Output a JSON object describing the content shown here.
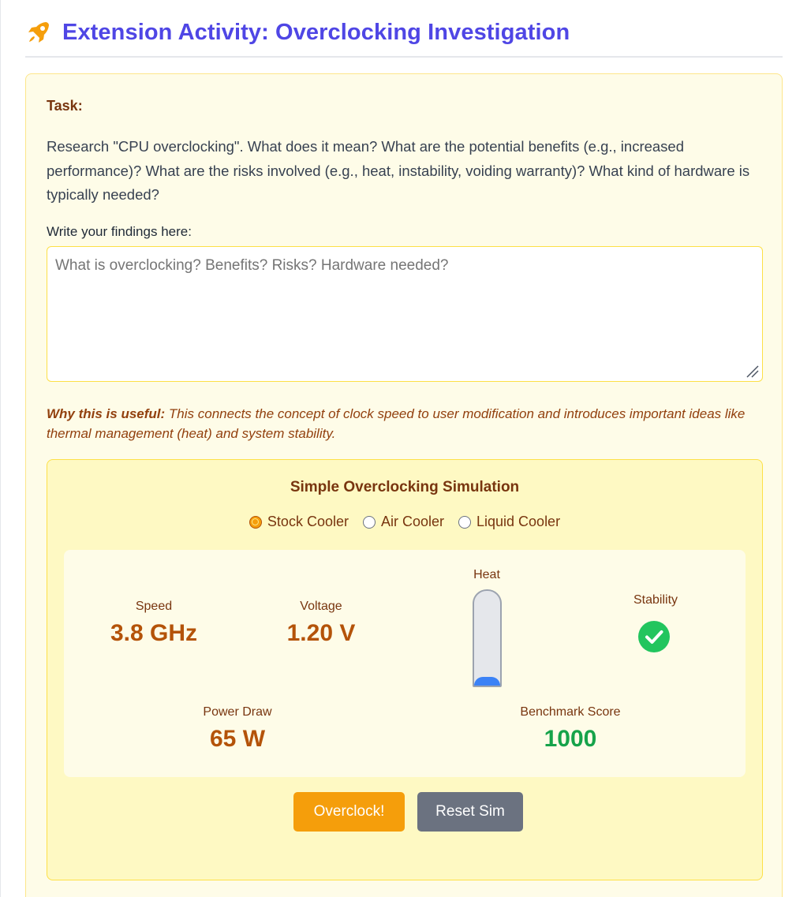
{
  "header": {
    "icon": "rocket-icon",
    "title": "Extension Activity: Overclocking Investigation"
  },
  "task": {
    "label": "Task:",
    "text": "Research \"CPU overclocking\". What does it mean? What are the potential benefits (e.g., increased performance)? What are the risks involved (e.g., heat, instability, voiding warranty)? What kind of hardware is typically needed?",
    "findings_label": "Write your findings here:",
    "findings_value": "",
    "findings_placeholder": "What is overclocking? Benefits? Risks? Hardware needed?",
    "why_prefix": "Why this is useful:",
    "why_text": "This connects the concept of clock speed to user modification and introduces important ideas like thermal management (heat) and system stability."
  },
  "simulation": {
    "title": "Simple Overclocking Simulation",
    "coolers": [
      {
        "label": "Stock Cooler",
        "checked": true
      },
      {
        "label": "Air Cooler",
        "checked": false
      },
      {
        "label": "Liquid Cooler",
        "checked": false
      }
    ],
    "speed": {
      "label": "Speed",
      "value": "3.8 GHz"
    },
    "voltage": {
      "label": "Voltage",
      "value": "1.20 V"
    },
    "heat": {
      "label": "Heat",
      "level_percent": 9
    },
    "stability": {
      "label": "Stability",
      "icon": "check-circle-icon",
      "status": "stable"
    },
    "power": {
      "label": "Power Draw",
      "value": "65 W"
    },
    "benchmark": {
      "label": "Benchmark Score",
      "value": "1000"
    },
    "overclock_label": "Overclock!",
    "reset_label": "Reset Sim"
  },
  "colors": {
    "title": "#4f46e5",
    "accent": "#f59e0b",
    "value": "#b45309",
    "benchmark": "#16a34a",
    "heat_fill": "#3b82f6",
    "stable": "#22c55e"
  }
}
